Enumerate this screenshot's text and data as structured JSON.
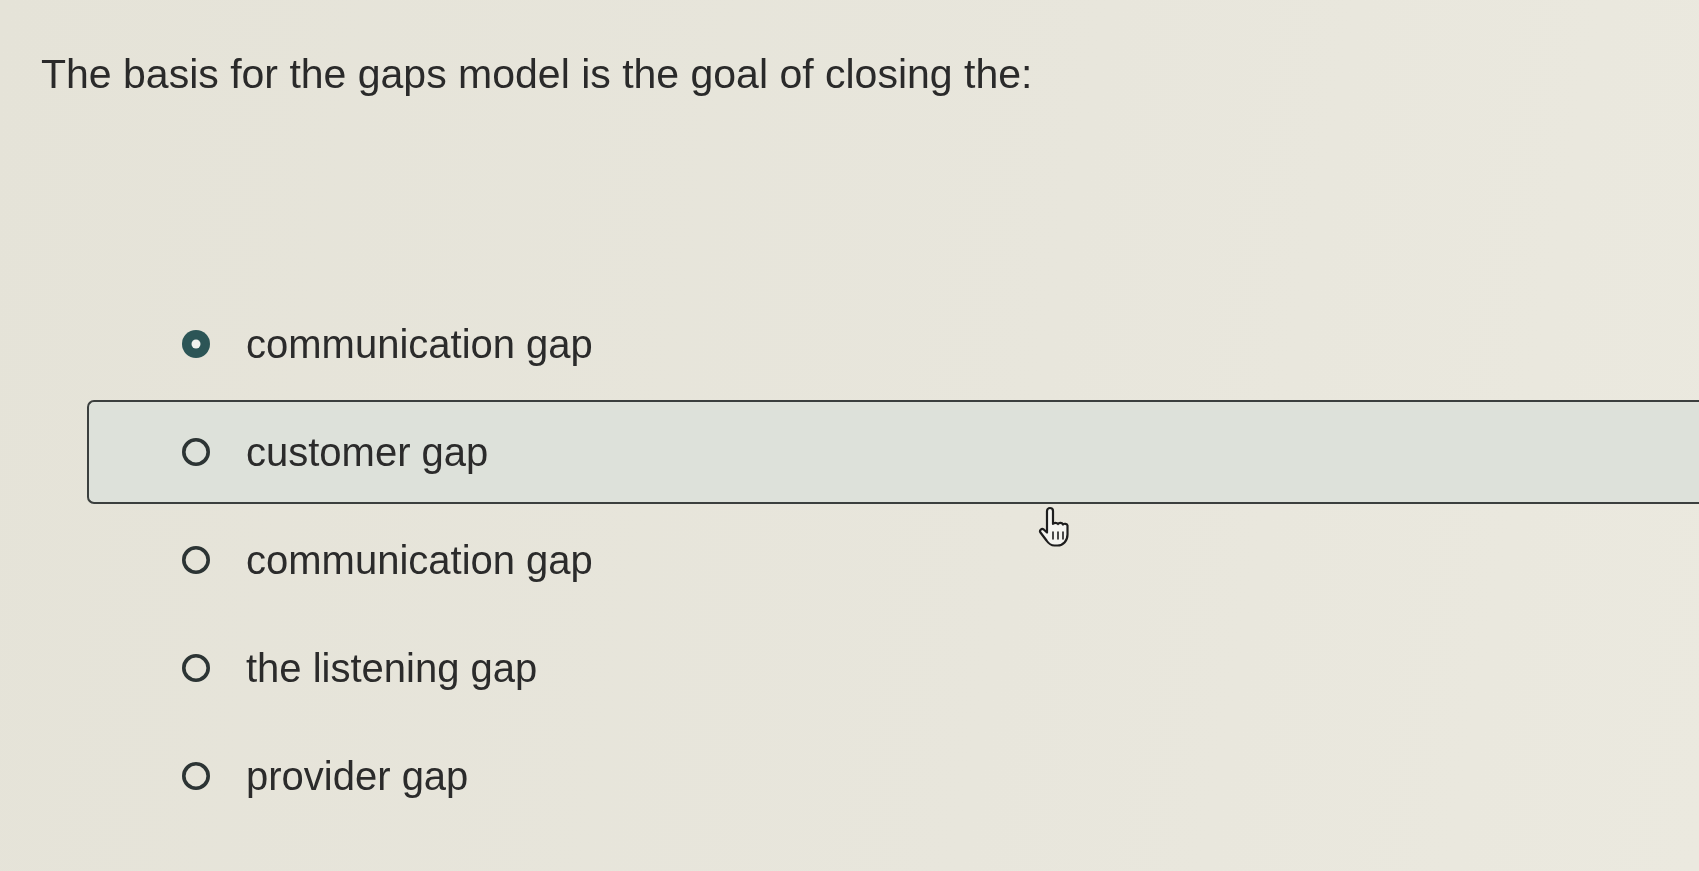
{
  "question": {
    "text": "The basis for the gaps model is the goal of closing the:"
  },
  "options": [
    {
      "label": "communication gap",
      "selected": true,
      "hovered": false
    },
    {
      "label": "customer gap",
      "selected": false,
      "hovered": true
    },
    {
      "label": "communication gap",
      "selected": false,
      "hovered": false
    },
    {
      "label": "the listening gap",
      "selected": false,
      "hovered": false
    },
    {
      "label": "provider gap",
      "selected": false,
      "hovered": false
    }
  ]
}
